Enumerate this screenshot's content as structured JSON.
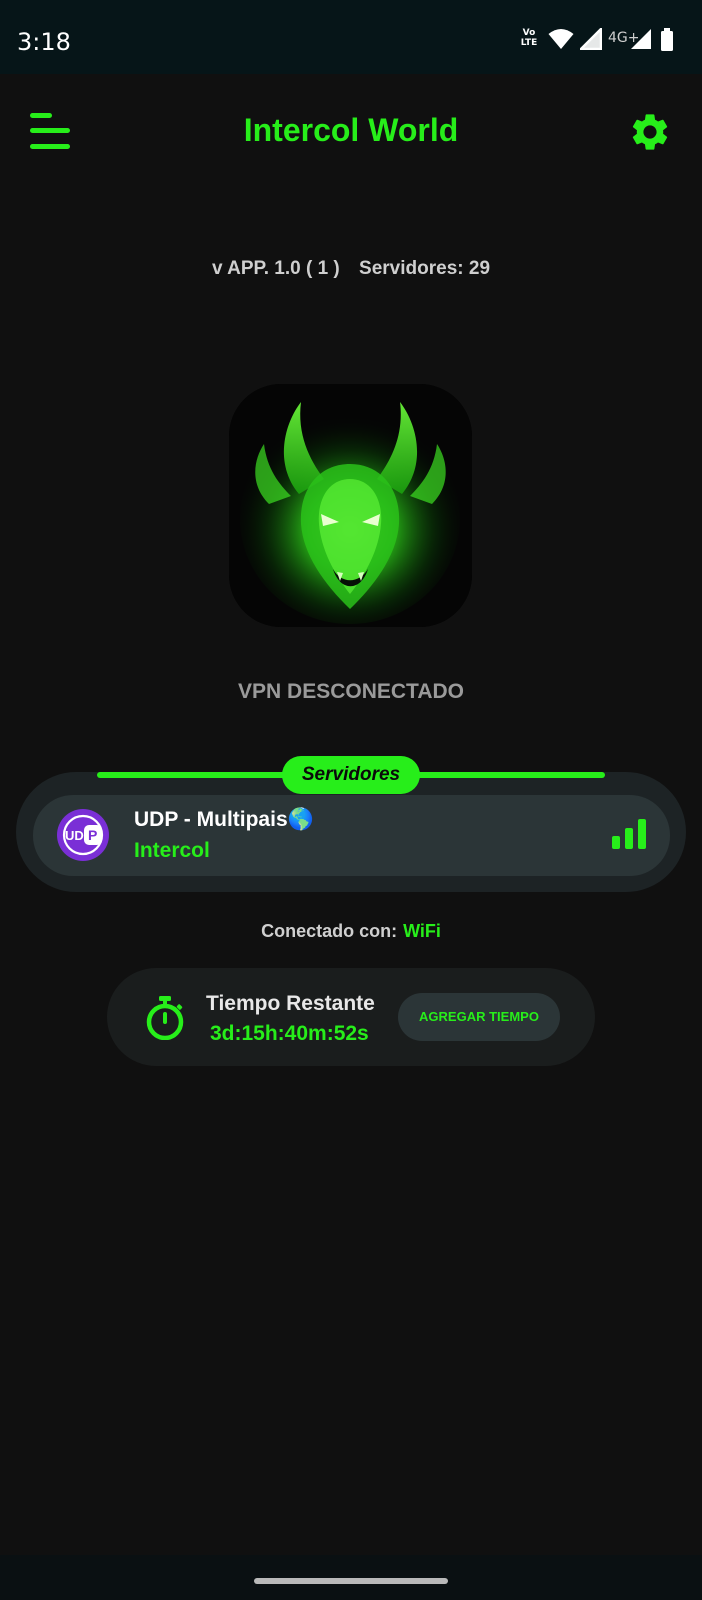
{
  "status_bar": {
    "time": "3:18",
    "volte_label": "Vo\nLTE",
    "network_type": "4G+",
    "icons": [
      "volte-icon",
      "wifi-icon",
      "signal-icon",
      "signal-4g-icon",
      "battery-icon"
    ]
  },
  "header": {
    "title": "Intercol World",
    "menu_icon": "menu-icon",
    "settings_icon": "gear-icon"
  },
  "info": {
    "version": "v APP. 1.0 ( 1 )",
    "servers_count": "Servidores: 29"
  },
  "logo": {
    "description_icon": "dragon-logo"
  },
  "vpn_status": "VPN DESCONECTADO",
  "servers_section": {
    "title": "Servidores",
    "selected_server": {
      "name": "UDP - Multipais🌎",
      "provider": "Intercol",
      "icon_text": "UDP",
      "signal_icon": "signal-bars-icon"
    }
  },
  "connection": {
    "label": "Conectado con:",
    "type": "WiFi"
  },
  "timer": {
    "label": "Tiempo Restante",
    "value": "3d:15h:40m:52s",
    "button": "AGREGAR TIEMPO"
  },
  "colors": {
    "accent": "#27EE1A",
    "background": "#101010",
    "status_bar": "#061518",
    "card": "#2B3537",
    "panel": "#1D2325"
  }
}
